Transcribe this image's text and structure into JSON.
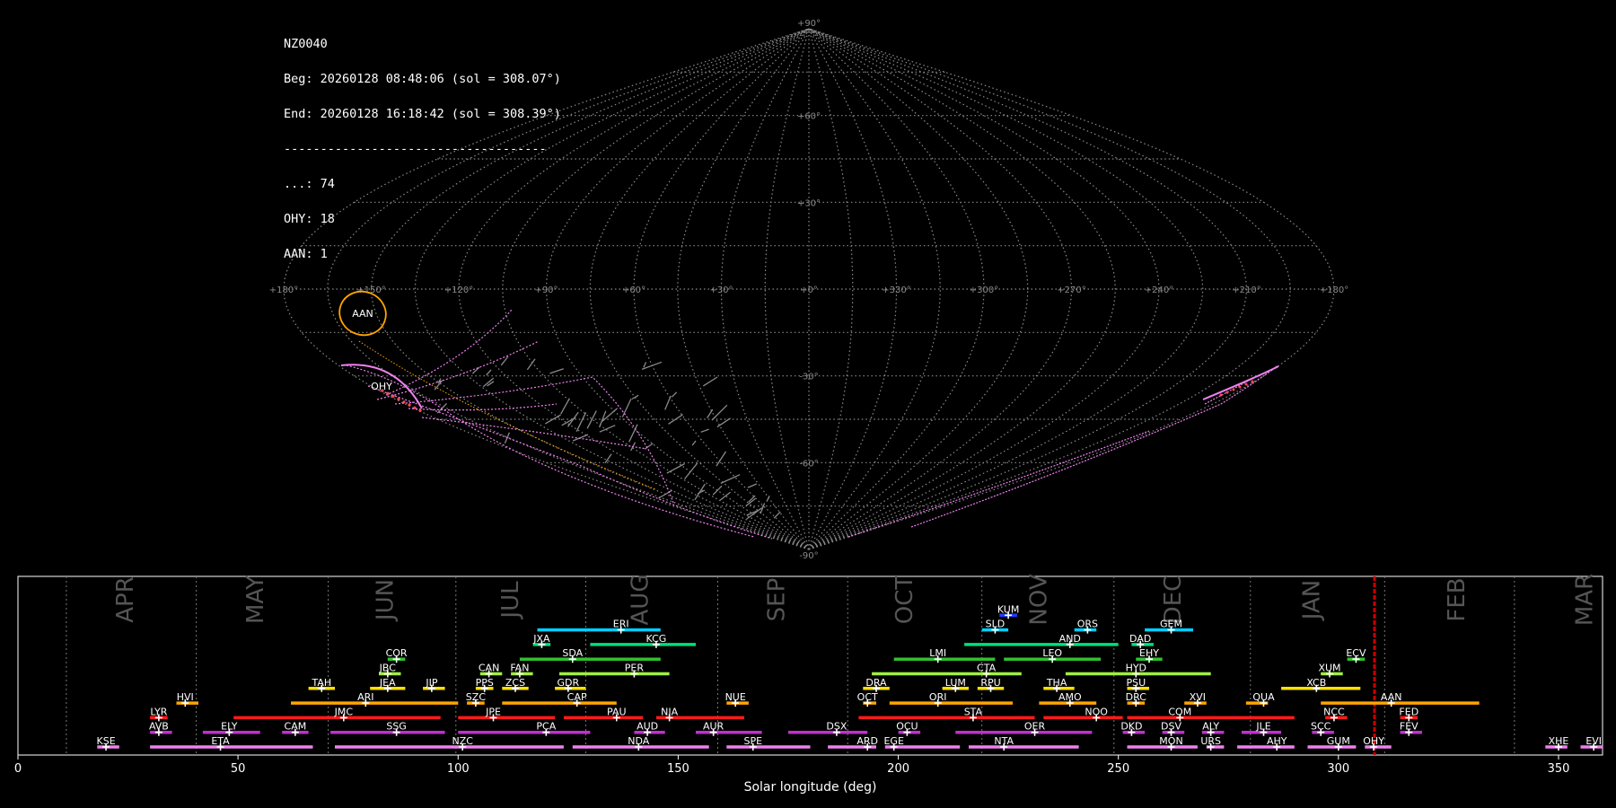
{
  "header": {
    "station": "NZ0040",
    "begin": "Beg: 20260128 08:48:06 (sol = 308.07°)",
    "end": "End: 20260128 16:18:42 (sol = 308.39°)",
    "separator": "------------------------------------",
    "counts": [
      "...: 74",
      "OHY: 18",
      "AAN: 1"
    ]
  },
  "sky_map": {
    "type": "sinusoidal-projection",
    "lon_labels": [
      "+180°",
      "+150°",
      "+120°",
      "+90°",
      "+60°",
      "+30°",
      "+0°",
      "+330°",
      "+300°",
      "+270°",
      "+240°",
      "+210°",
      "+180°"
    ],
    "lat_labels": [
      "+90°",
      "+60°",
      "+30°",
      "-30°",
      "-60°",
      "-90°"
    ],
    "radiants": [
      {
        "code": "AAN",
        "color": "#ffa500"
      },
      {
        "code": "OHY",
        "color": "#ff4d4d"
      }
    ]
  },
  "chart_data": {
    "type": "timeline",
    "xlabel": "Solar longitude (deg)",
    "xlim": [
      0,
      360
    ],
    "xticks": [
      0,
      50,
      100,
      150,
      200,
      250,
      300,
      350
    ],
    "current_sol": 308.2,
    "months": [
      {
        "name": "APR",
        "x": 24.5
      },
      {
        "name": "MAY",
        "x": 54
      },
      {
        "name": "JUN",
        "x": 83.5
      },
      {
        "name": "JUL",
        "x": 112
      },
      {
        "name": "AUG",
        "x": 141.5
      },
      {
        "name": "SEP",
        "x": 172.5
      },
      {
        "name": "OCT",
        "x": 201.5
      },
      {
        "name": "NOV",
        "x": 232
      },
      {
        "name": "DEC",
        "x": 262.5
      },
      {
        "name": "JAN",
        "x": 294
      },
      {
        "name": "FEB",
        "x": 327
      },
      {
        "name": "MAR",
        "x": 356
      }
    ],
    "month_boundaries": [
      11,
      40.5,
      70.5,
      99.5,
      129,
      159,
      188.5,
      219,
      249,
      280,
      310.5,
      340
    ],
    "showers": [
      {
        "code": "KUM",
        "start": 223,
        "end": 227,
        "peak": 225,
        "row": 10,
        "color": "#1e3cff"
      },
      {
        "code": "ERI",
        "start": 118,
        "end": 146,
        "peak": 137,
        "row": 9,
        "color": "#00d0ff"
      },
      {
        "code": "SLD",
        "start": 219,
        "end": 225,
        "peak": 222,
        "row": 9,
        "color": "#00d0ff"
      },
      {
        "code": "ORS",
        "start": 240,
        "end": 245,
        "peak": 243,
        "row": 9,
        "color": "#00d0ff"
      },
      {
        "code": "GEM",
        "start": 256,
        "end": 267,
        "peak": 262,
        "row": 9,
        "color": "#00d0ff"
      },
      {
        "code": "JXA",
        "start": 117,
        "end": 121,
        "peak": 119,
        "row": 8,
        "color": "#00e07a"
      },
      {
        "code": "KCG",
        "start": 130,
        "end": 154,
        "peak": 145,
        "row": 8,
        "color": "#00e07a"
      },
      {
        "code": "AND",
        "start": 215,
        "end": 250,
        "peak": 239,
        "row": 8,
        "color": "#00e07a"
      },
      {
        "code": "DAD",
        "start": 253,
        "end": 258,
        "peak": 255,
        "row": 8,
        "color": "#00e07a"
      },
      {
        "code": "COR",
        "start": 84,
        "end": 88,
        "peak": 86,
        "row": 7,
        "color": "#30c030"
      },
      {
        "code": "SDA",
        "start": 114,
        "end": 146,
        "peak": 126,
        "row": 7,
        "color": "#30c030"
      },
      {
        "code": "LMI",
        "start": 199,
        "end": 222,
        "peak": 209,
        "row": 7,
        "color": "#30c030"
      },
      {
        "code": "LEO",
        "start": 224,
        "end": 246,
        "peak": 235,
        "row": 7,
        "color": "#30c030"
      },
      {
        "code": "EHY",
        "start": 254,
        "end": 260,
        "peak": 257,
        "row": 7,
        "color": "#30c030"
      },
      {
        "code": "ECV",
        "start": 302,
        "end": 306,
        "peak": 304,
        "row": 7,
        "color": "#30c030"
      },
      {
        "code": "JBC",
        "start": 82,
        "end": 87,
        "peak": 84,
        "row": 6,
        "color": "#a0f040"
      },
      {
        "code": "CAN",
        "start": 105,
        "end": 110,
        "peak": 107,
        "row": 6,
        "color": "#a0f040"
      },
      {
        "code": "FAN",
        "start": 112,
        "end": 117,
        "peak": 114,
        "row": 6,
        "color": "#a0f040"
      },
      {
        "code": "PER",
        "start": 123,
        "end": 148,
        "peak": 140,
        "row": 6,
        "color": "#a0f040"
      },
      {
        "code": "CTA",
        "start": 194,
        "end": 228,
        "peak": 220,
        "row": 6,
        "color": "#a0f040"
      },
      {
        "code": "HYD",
        "start": 238,
        "end": 271,
        "peak": 254,
        "row": 6,
        "color": "#a0f040"
      },
      {
        "code": "XUM",
        "start": 296,
        "end": 301,
        "peak": 298,
        "row": 6,
        "color": "#a0f040"
      },
      {
        "code": "TAH",
        "start": 66,
        "end": 72,
        "peak": 69,
        "row": 5,
        "color": "#ffe000"
      },
      {
        "code": "JEA",
        "start": 80,
        "end": 88,
        "peak": 84,
        "row": 5,
        "color": "#ffe000"
      },
      {
        "code": "JIP",
        "start": 92,
        "end": 97,
        "peak": 94,
        "row": 5,
        "color": "#ffe000"
      },
      {
        "code": "PPS",
        "start": 104,
        "end": 108,
        "peak": 106,
        "row": 5,
        "color": "#ffe000"
      },
      {
        "code": "ZCS",
        "start": 110,
        "end": 116,
        "peak": 113,
        "row": 5,
        "color": "#ffe000"
      },
      {
        "code": "GDR",
        "start": 122,
        "end": 129,
        "peak": 125,
        "row": 5,
        "color": "#ffe000"
      },
      {
        "code": "DRA",
        "start": 192,
        "end": 198,
        "peak": 195,
        "row": 5,
        "color": "#ffe000"
      },
      {
        "code": "LUM",
        "start": 210,
        "end": 216,
        "peak": 213,
        "row": 5,
        "color": "#ffe000"
      },
      {
        "code": "RPU",
        "start": 218,
        "end": 224,
        "peak": 221,
        "row": 5,
        "color": "#ffe000"
      },
      {
        "code": "THA",
        "start": 233,
        "end": 240,
        "peak": 236,
        "row": 5,
        "color": "#ffe000"
      },
      {
        "code": "PSU",
        "start": 252,
        "end": 257,
        "peak": 254,
        "row": 5,
        "color": "#ffe000"
      },
      {
        "code": "XCB",
        "start": 287,
        "end": 305,
        "peak": 295,
        "row": 5,
        "color": "#ffe000"
      },
      {
        "code": "HVI",
        "start": 36,
        "end": 41,
        "peak": 38,
        "row": 4,
        "color": "#ffa500"
      },
      {
        "code": "ARI",
        "start": 62,
        "end": 100,
        "peak": 79,
        "row": 4,
        "color": "#ffa500"
      },
      {
        "code": "SZC",
        "start": 102,
        "end": 106,
        "peak": 104,
        "row": 4,
        "color": "#ffa500"
      },
      {
        "code": "CAP",
        "start": 110,
        "end": 136,
        "peak": 127,
        "row": 4,
        "color": "#ffa500"
      },
      {
        "code": "NUE",
        "start": 161,
        "end": 166,
        "peak": 163,
        "row": 4,
        "color": "#ffa500"
      },
      {
        "code": "OCT",
        "start": 192,
        "end": 195,
        "peak": 193,
        "row": 4,
        "color": "#ffa500"
      },
      {
        "code": "ORI",
        "start": 198,
        "end": 226,
        "peak": 209,
        "row": 4,
        "color": "#ffa500"
      },
      {
        "code": "AMO",
        "start": 232,
        "end": 245,
        "peak": 239,
        "row": 4,
        "color": "#ffa500"
      },
      {
        "code": "DRC",
        "start": 252,
        "end": 256,
        "peak": 254,
        "row": 4,
        "color": "#ffa500"
      },
      {
        "code": "XVI",
        "start": 265,
        "end": 270,
        "peak": 268,
        "row": 4,
        "color": "#ffa500"
      },
      {
        "code": "QUA",
        "start": 279,
        "end": 284,
        "peak": 283,
        "row": 4,
        "color": "#ffa500"
      },
      {
        "code": "AAN",
        "start": 296,
        "end": 332,
        "peak": 312,
        "row": 4,
        "color": "#ffa500"
      },
      {
        "code": "LYR",
        "start": 30,
        "end": 34,
        "peak": 32,
        "row": 3,
        "color": "#ff1a1a"
      },
      {
        "code": "JMC",
        "start": 49,
        "end": 96,
        "peak": 74,
        "row": 3,
        "color": "#ff1a1a"
      },
      {
        "code": "JPE",
        "start": 100,
        "end": 122,
        "peak": 108,
        "row": 3,
        "color": "#ff1a1a"
      },
      {
        "code": "PAU",
        "start": 124,
        "end": 142,
        "peak": 136,
        "row": 3,
        "color": "#ff1a1a"
      },
      {
        "code": "NIA",
        "start": 145,
        "end": 165,
        "peak": 148,
        "row": 3,
        "color": "#ff1a1a"
      },
      {
        "code": "STA",
        "start": 191,
        "end": 231,
        "peak": 217,
        "row": 3,
        "color": "#ff1a1a"
      },
      {
        "code": "NOO",
        "start": 233,
        "end": 251,
        "peak": 245,
        "row": 3,
        "color": "#ff1a1a"
      },
      {
        "code": "COM",
        "start": 252,
        "end": 290,
        "peak": 264,
        "row": 3,
        "color": "#ff1a1a"
      },
      {
        "code": "NCC",
        "start": 297,
        "end": 302,
        "peak": 299,
        "row": 3,
        "color": "#ff1a1a"
      },
      {
        "code": "FED",
        "start": 314,
        "end": 318,
        "peak": 316,
        "row": 3,
        "color": "#ff1a1a"
      },
      {
        "code": "AVB",
        "start": 30,
        "end": 35,
        "peak": 32,
        "row": 2,
        "color": "#c030d0"
      },
      {
        "code": "ELY",
        "start": 42,
        "end": 55,
        "peak": 48,
        "row": 2,
        "color": "#c030d0"
      },
      {
        "code": "CAM",
        "start": 60,
        "end": 66,
        "peak": 63,
        "row": 2,
        "color": "#c030d0"
      },
      {
        "code": "SSG",
        "start": 71,
        "end": 97,
        "peak": 86,
        "row": 2,
        "color": "#c030d0"
      },
      {
        "code": "PCA",
        "start": 100,
        "end": 130,
        "peak": 120,
        "row": 2,
        "color": "#c030d0"
      },
      {
        "code": "AUD",
        "start": 140,
        "end": 147,
        "peak": 143,
        "row": 2,
        "color": "#c030d0"
      },
      {
        "code": "AUR",
        "start": 154,
        "end": 169,
        "peak": 158,
        "row": 2,
        "color": "#c030d0"
      },
      {
        "code": "DSX",
        "start": 175,
        "end": 193,
        "peak": 186,
        "row": 2,
        "color": "#c030d0"
      },
      {
        "code": "OCU",
        "start": 200,
        "end": 205,
        "peak": 202,
        "row": 2,
        "color": "#c030d0"
      },
      {
        "code": "OER",
        "start": 213,
        "end": 244,
        "peak": 231,
        "row": 2,
        "color": "#c030d0"
      },
      {
        "code": "DKD",
        "start": 251,
        "end": 256,
        "peak": 253,
        "row": 2,
        "color": "#c030d0"
      },
      {
        "code": "DSV",
        "start": 260,
        "end": 265,
        "peak": 262,
        "row": 2,
        "color": "#c030d0"
      },
      {
        "code": "ALY",
        "start": 269,
        "end": 274,
        "peak": 271,
        "row": 2,
        "color": "#c030d0"
      },
      {
        "code": "JLE",
        "start": 278,
        "end": 287,
        "peak": 283,
        "row": 2,
        "color": "#c030d0"
      },
      {
        "code": "SCC",
        "start": 294,
        "end": 299,
        "peak": 296,
        "row": 2,
        "color": "#c030d0"
      },
      {
        "code": "FEV",
        "start": 314,
        "end": 319,
        "peak": 316,
        "row": 2,
        "color": "#c030d0"
      },
      {
        "code": "KSE",
        "start": 18,
        "end": 23,
        "peak": 20,
        "row": 1,
        "color": "#f080f0"
      },
      {
        "code": "ETA",
        "start": 30,
        "end": 67,
        "peak": 46,
        "row": 1,
        "color": "#f080f0"
      },
      {
        "code": "NZC",
        "start": 72,
        "end": 124,
        "peak": 101,
        "row": 1,
        "color": "#f080f0"
      },
      {
        "code": "NDA",
        "start": 126,
        "end": 157,
        "peak": 141,
        "row": 1,
        "color": "#f080f0"
      },
      {
        "code": "SPE",
        "start": 161,
        "end": 180,
        "peak": 167,
        "row": 1,
        "color": "#f080f0"
      },
      {
        "code": "ARD",
        "start": 184,
        "end": 195,
        "peak": 193,
        "row": 1,
        "color": "#f080f0"
      },
      {
        "code": "EGE",
        "start": 197,
        "end": 214,
        "peak": 199,
        "row": 1,
        "color": "#f080f0"
      },
      {
        "code": "NTA",
        "start": 216,
        "end": 241,
        "peak": 224,
        "row": 1,
        "color": "#f080f0"
      },
      {
        "code": "MON",
        "start": 252,
        "end": 268,
        "peak": 262,
        "row": 1,
        "color": "#f080f0"
      },
      {
        "code": "URS",
        "start": 270,
        "end": 274,
        "peak": 271,
        "row": 1,
        "color": "#f080f0"
      },
      {
        "code": "AHY",
        "start": 277,
        "end": 290,
        "peak": 286,
        "row": 1,
        "color": "#f080f0"
      },
      {
        "code": "GUM",
        "start": 293,
        "end": 304,
        "peak": 300,
        "row": 1,
        "color": "#f080f0"
      },
      {
        "code": "OHY",
        "start": 306,
        "end": 312,
        "peak": 308,
        "row": 1,
        "color": "#f080f0"
      },
      {
        "code": "XHE",
        "start": 347,
        "end": 352,
        "peak": 350,
        "row": 1,
        "color": "#f080f0"
      },
      {
        "code": "EVI",
        "start": 355,
        "end": 360,
        "peak": 358,
        "row": 1,
        "color": "#f080f0"
      }
    ]
  }
}
